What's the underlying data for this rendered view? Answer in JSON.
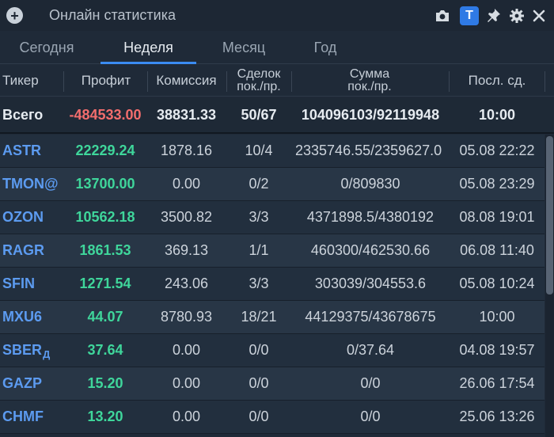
{
  "window": {
    "title": "Онлайн статистика",
    "t_button": "T"
  },
  "tabs": [
    {
      "label": "Сегодня"
    },
    {
      "label": "Неделя"
    },
    {
      "label": "Месяц"
    },
    {
      "label": "Год"
    }
  ],
  "active_tab": "Неделя",
  "columns": {
    "ticker": "Тикер",
    "profit": "Профит",
    "commission": "Комиссия",
    "deals_1": "Сделок",
    "deals_2": "пок./пр.",
    "sum_1": "Сумма",
    "sum_2": "пок./пр.",
    "last": "Посл. сд."
  },
  "total": {
    "label": "Всего",
    "profit": "-484533.00",
    "commission": "38831.33",
    "deals": "50/67",
    "sum": "104096103/92119948",
    "last": "10:00"
  },
  "rows": [
    {
      "ticker": "ASTR",
      "profit": "22229.24",
      "commission": "1878.16",
      "deals": "10/4",
      "sum": "2335746.55/2359627.0",
      "last": "05.08 22:22"
    },
    {
      "ticker": "TMON@",
      "profit": "13700.00",
      "commission": "0.00",
      "deals": "0/2",
      "sum": "0/809830",
      "last": "05.08 23:29"
    },
    {
      "ticker": "OZON",
      "profit": "10562.18",
      "commission": "3500.82",
      "deals": "3/3",
      "sum": "4371898.5/4380192",
      "last": "08.08 19:01"
    },
    {
      "ticker": "RAGR",
      "profit": "1861.53",
      "commission": "369.13",
      "deals": "1/1",
      "sum": "460300/462530.66",
      "last": "06.08 11:40"
    },
    {
      "ticker": "SFIN",
      "profit": "1271.54",
      "commission": "243.06",
      "deals": "3/3",
      "sum": "303039/304553.6",
      "last": "05.08 10:24"
    },
    {
      "ticker": "MXU6",
      "profit": "44.07",
      "commission": "8780.93",
      "deals": "18/21",
      "sum": "44129375/43678675",
      "last": "10:00"
    },
    {
      "ticker": "SBER",
      "ticker_sub": "Д",
      "profit": "37.64",
      "commission": "0.00",
      "deals": "0/0",
      "sum": "0/37.64",
      "last": "04.08 19:57"
    },
    {
      "ticker": "GAZP",
      "profit": "15.20",
      "commission": "0.00",
      "deals": "0/0",
      "sum": "0/0",
      "last": "26.06 17:54"
    },
    {
      "ticker": "CHMF",
      "profit": "13.20",
      "commission": "0.00",
      "deals": "0/0",
      "sum": "0/0",
      "last": "25.06 13:26"
    }
  ],
  "colors": {
    "accent": "#3b8cf2",
    "ticker": "#5c9bf0",
    "profit_positive": "#3fd69b",
    "profit_negative": "#f26d6d"
  },
  "icons": [
    "add-icon",
    "camera-icon",
    "pin-icon",
    "settings-icon",
    "close-icon"
  ]
}
